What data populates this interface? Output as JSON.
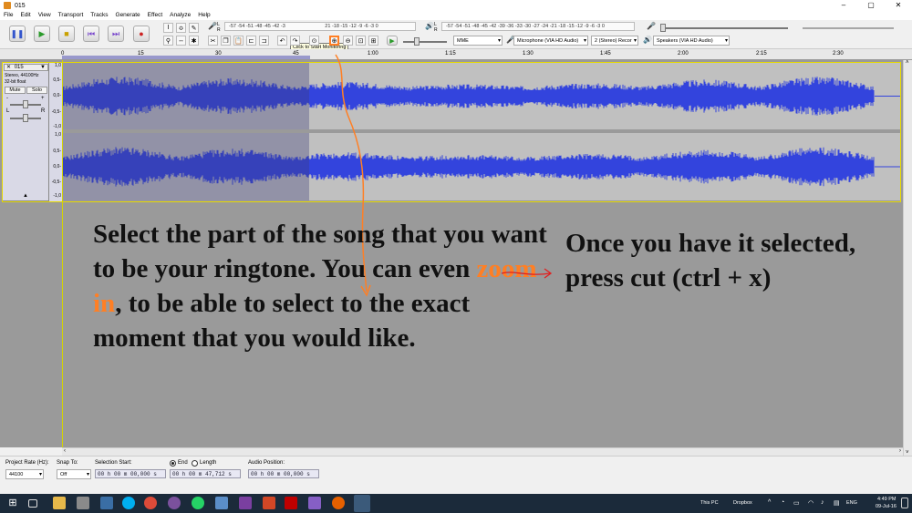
{
  "window": {
    "title": "015",
    "minimize": "–",
    "maximize": "▢",
    "close": "✕"
  },
  "menu": [
    "File",
    "Edit",
    "View",
    "Transport",
    "Tracks",
    "Generate",
    "Effect",
    "Analyze",
    "Help"
  ],
  "toolbar": {
    "tooltip": "Click to Start Monitoring",
    "record_meter_scale": "-57 -54 -51 -48 -45 -42 -3",
    "record_meter_scale_2": "21 -18 -15 -12 -9 -6 -3 0",
    "play_meter_scale": "-57 -54 -51 -48 -45 -42 -39 -36 -33 -30 -27 -24 -21 -18 -15 -12 -9 -6 -3 0",
    "meter_lr": "L R",
    "host": "MME",
    "recording_device": "Microphone (VIA HD Audio)",
    "channels": "2 (Stereo) Recor",
    "playback_device": "Speakers (VIA HD Audio)",
    "accent_color": "#3344cc"
  },
  "ruler": {
    "ticks": [
      "0",
      "15",
      "30",
      "45",
      "1:00",
      "1:15",
      "1:30",
      "1:45",
      "2:00",
      "2:15",
      "2:30"
    ]
  },
  "track": {
    "name": "015",
    "info_rate": "Stereo, 44100Hz",
    "info_format": "32-bit float",
    "mute": "Mute",
    "solo": "Solo",
    "gain_minus": "-",
    "gain_plus": "+",
    "pan_l": "L",
    "pan_r": "R",
    "scale_top": "1,0",
    "scale_q1": "0,5-",
    "scale_mid": "0,0-",
    "scale_q3": "-0,5-",
    "scale_bottom": "-1,0",
    "wave_color": "#3344dd"
  },
  "annotations": {
    "main_before": "Select the part of the song that you want to be your ringtone. You can even ",
    "main_highlight": "zoom in",
    "main_after": ", to be able to select to the exact moment that you would like.",
    "side": "Once you have it selected, press cut (ctrl + x)",
    "highlight_color": "#ff7f24"
  },
  "selection_bar": {
    "project_rate_label": "Project Rate (Hz):",
    "project_rate": "44100",
    "snap_label": "Snap To:",
    "snap_value": "Off",
    "sel_start_label": "Selection Start:",
    "end_label": "End",
    "length_label": "Length",
    "sel_start": "00 h 00 m 00,000 s",
    "sel_end": "00 h 00 m 47,712 s",
    "audio_pos_label": "Audio Position:",
    "audio_pos": "00 h 00 m 00,000 s"
  },
  "taskbar": {
    "this_pc": "This PC",
    "dropbox": "Dropbox",
    "lang": "ENG",
    "time": "4:49 PM",
    "date": "09-Jul-16"
  }
}
